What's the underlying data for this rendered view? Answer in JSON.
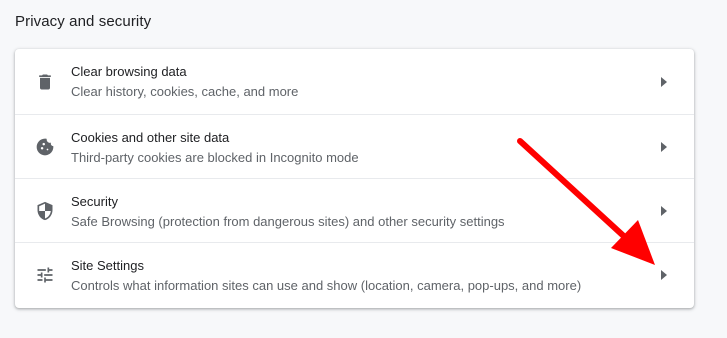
{
  "section": {
    "title": "Privacy and security"
  },
  "items": [
    {
      "icon": "trash-icon",
      "label": "Clear browsing data",
      "sublabel": "Clear history, cookies, cache, and more"
    },
    {
      "icon": "cookie-icon",
      "label": "Cookies and other site data",
      "sublabel": "Third-party cookies are blocked in Incognito mode"
    },
    {
      "icon": "shield-icon",
      "label": "Security",
      "sublabel": "Safe Browsing (protection from dangerous sites) and other security settings"
    },
    {
      "icon": "sliders-icon",
      "label": "Site Settings",
      "sublabel": "Controls what information sites can use and show (location, camera, pop-ups, and more)"
    }
  ],
  "colors": {
    "background": "#f7f8fa",
    "card": "#ffffff",
    "text_primary": "#202124",
    "text_secondary": "#5f6368",
    "annotation_arrow": "#ff0000"
  }
}
